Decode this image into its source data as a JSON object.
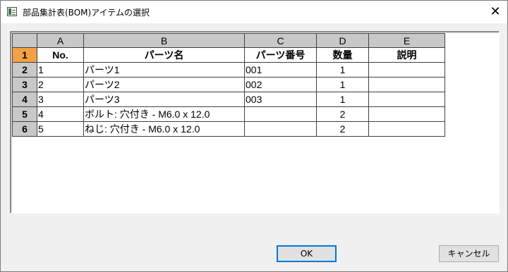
{
  "window": {
    "title": "部品集計表(BOM)アイテムの選択",
    "close_glyph": "✕"
  },
  "grid": {
    "column_letters": [
      "A",
      "B",
      "C",
      "D",
      "E"
    ],
    "row_numbers": [
      "1",
      "2",
      "3",
      "4",
      "5",
      "6"
    ],
    "header_row": [
      "No.",
      "パーツ名",
      "パーツ番号",
      "数量",
      "説明"
    ],
    "rows": [
      [
        "1",
        "パーツ1",
        "001",
        "1",
        ""
      ],
      [
        "2",
        "パーツ2",
        "002",
        "1",
        ""
      ],
      [
        "3",
        "パーツ3",
        "003",
        "1",
        ""
      ],
      [
        "4",
        "ボルト: 穴付き - M6.0 x 12.0",
        "",
        "2",
        ""
      ],
      [
        "5",
        "ねじ: 穴付き - M6.0 x 12.0",
        "",
        "2",
        ""
      ]
    ],
    "active_row_color": "#f5a043",
    "header_bg_color": "#c8c8c8"
  },
  "buttons": {
    "ok_label": "OK",
    "cancel_label": "キャンセル"
  }
}
